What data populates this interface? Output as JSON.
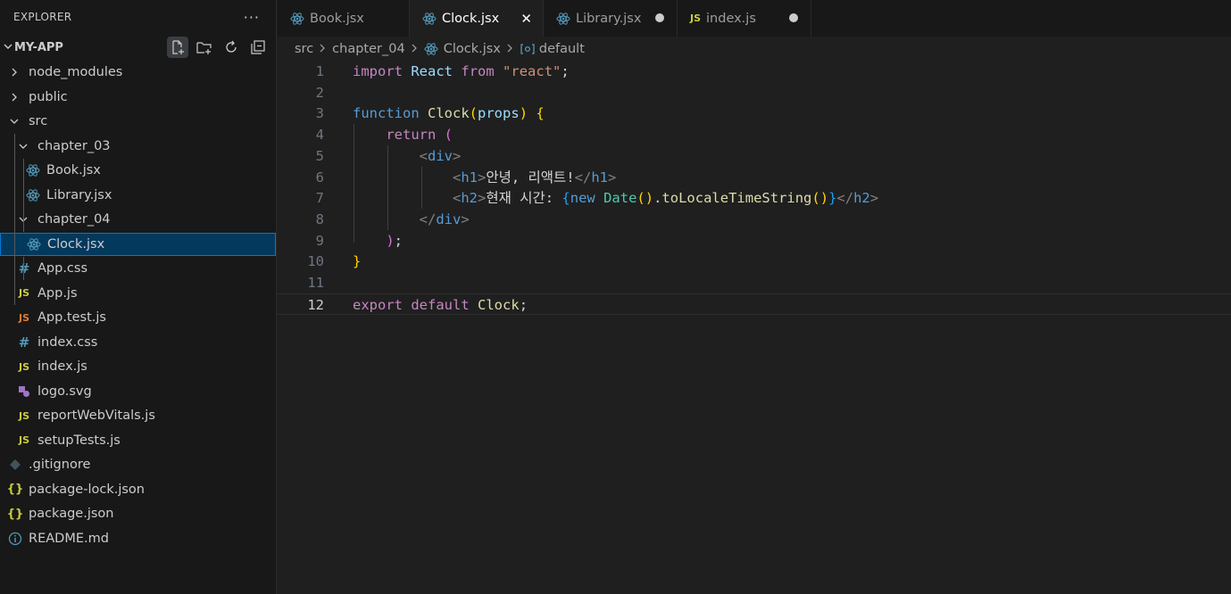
{
  "sidebar": {
    "title": "EXPLORER",
    "more": "···",
    "project": "MY-APP",
    "items": [
      {
        "label": "node_modules",
        "type": "folder",
        "open": false,
        "depth": 0
      },
      {
        "label": "public",
        "type": "folder",
        "open": false,
        "depth": 0
      },
      {
        "label": "src",
        "type": "folder",
        "open": true,
        "depth": 0
      },
      {
        "label": "chapter_03",
        "type": "folder",
        "open": true,
        "depth": 1
      },
      {
        "label": "Book.jsx",
        "type": "react",
        "depth": 2
      },
      {
        "label": "Library.jsx",
        "type": "react",
        "depth": 2
      },
      {
        "label": "chapter_04",
        "type": "folder",
        "open": true,
        "depth": 1
      },
      {
        "label": "Clock.jsx",
        "type": "react",
        "depth": 2,
        "selected": true
      },
      {
        "label": "App.css",
        "type": "css",
        "depth": 1
      },
      {
        "label": "App.js",
        "type": "js",
        "depth": 1
      },
      {
        "label": "App.test.js",
        "type": "test",
        "depth": 1
      },
      {
        "label": "index.css",
        "type": "css",
        "depth": 1
      },
      {
        "label": "index.js",
        "type": "js",
        "depth": 1
      },
      {
        "label": "logo.svg",
        "type": "svg",
        "depth": 1
      },
      {
        "label": "reportWebVitals.js",
        "type": "js",
        "depth": 1
      },
      {
        "label": "setupTests.js",
        "type": "js",
        "depth": 1
      },
      {
        "label": ".gitignore",
        "type": "git",
        "depth": 0
      },
      {
        "label": "package-lock.json",
        "type": "json",
        "depth": 0
      },
      {
        "label": "package.json",
        "type": "json",
        "depth": 0
      },
      {
        "label": "README.md",
        "type": "info",
        "depth": 0
      }
    ]
  },
  "tabs": [
    {
      "label": "Book.jsx",
      "icon": "react",
      "active": false,
      "modified": false
    },
    {
      "label": "Clock.jsx",
      "icon": "react",
      "active": true,
      "modified": false
    },
    {
      "label": "Library.jsx",
      "icon": "react",
      "active": false,
      "modified": true
    },
    {
      "label": "index.js",
      "icon": "js",
      "active": false,
      "modified": true
    }
  ],
  "breadcrumb": [
    "src",
    "chapter_04",
    "Clock.jsx",
    "default"
  ],
  "editor": {
    "current_line": 12,
    "lines": [
      {
        "n": "1",
        "tokens": [
          [
            "kw",
            "import"
          ],
          [
            "txt",
            " "
          ],
          [
            "var",
            "React"
          ],
          [
            "txt",
            " "
          ],
          [
            "kw",
            "from"
          ],
          [
            "txt",
            " "
          ],
          [
            "str",
            "\"react\""
          ],
          [
            "txt",
            ";"
          ]
        ]
      },
      {
        "n": "2",
        "tokens": []
      },
      {
        "n": "3",
        "tokens": [
          [
            "kw2",
            "function"
          ],
          [
            "txt",
            " "
          ],
          [
            "fn",
            "Clock"
          ],
          [
            "br1",
            "("
          ],
          [
            "var",
            "props"
          ],
          [
            "br1",
            ")"
          ],
          [
            "txt",
            " "
          ],
          [
            "br1",
            "{"
          ]
        ]
      },
      {
        "n": "4",
        "tokens": [
          [
            "txt",
            "    "
          ],
          [
            "kw",
            "return"
          ],
          [
            "txt",
            " "
          ],
          [
            "br2",
            "("
          ]
        ]
      },
      {
        "n": "5",
        "tokens": [
          [
            "txt",
            "        "
          ],
          [
            "punct",
            "<"
          ],
          [
            "tag",
            "div"
          ],
          [
            "punct",
            ">"
          ]
        ]
      },
      {
        "n": "6",
        "tokens": [
          [
            "txt",
            "            "
          ],
          [
            "punct",
            "<"
          ],
          [
            "tag",
            "h1"
          ],
          [
            "punct",
            ">"
          ],
          [
            "txt",
            "안녕, 리액트!"
          ],
          [
            "punct",
            "</"
          ],
          [
            "tag",
            "h1"
          ],
          [
            "punct",
            ">"
          ]
        ]
      },
      {
        "n": "7",
        "tokens": [
          [
            "txt",
            "            "
          ],
          [
            "punct",
            "<"
          ],
          [
            "tag",
            "h2"
          ],
          [
            "punct",
            ">"
          ],
          [
            "txt",
            "현재 시간: "
          ],
          [
            "br3",
            "{"
          ],
          [
            "kw2",
            "new"
          ],
          [
            "txt",
            " "
          ],
          [
            "cls",
            "Date"
          ],
          [
            "br1",
            "()"
          ],
          [
            "txt",
            "."
          ],
          [
            "fn",
            "toLocaleTimeString"
          ],
          [
            "br1",
            "()"
          ],
          [
            "br3",
            "}"
          ],
          [
            "punct",
            "</"
          ],
          [
            "tag",
            "h2"
          ],
          [
            "punct",
            ">"
          ]
        ]
      },
      {
        "n": "8",
        "tokens": [
          [
            "txt",
            "        "
          ],
          [
            "punct",
            "</"
          ],
          [
            "tag",
            "div"
          ],
          [
            "punct",
            ">"
          ]
        ]
      },
      {
        "n": "9",
        "tokens": [
          [
            "txt",
            "    "
          ],
          [
            "br2",
            ")"
          ],
          [
            "txt",
            ";"
          ]
        ]
      },
      {
        "n": "10",
        "tokens": [
          [
            "br1",
            "}"
          ]
        ]
      },
      {
        "n": "11",
        "tokens": []
      },
      {
        "n": "12",
        "tokens": [
          [
            "kw",
            "export"
          ],
          [
            "txt",
            " "
          ],
          [
            "kw",
            "default"
          ],
          [
            "txt",
            " "
          ],
          [
            "fn",
            "Clock"
          ],
          [
            "txt",
            ";"
          ]
        ]
      }
    ]
  },
  "colors": {
    "react": "#519aba",
    "js": "#cbcb41",
    "css": "#519aba",
    "test": "#e37933",
    "svg": "#a074c4",
    "json": "#cbcb41",
    "git": "#41535b",
    "info": "#519aba",
    "accent": "#0078d4"
  }
}
